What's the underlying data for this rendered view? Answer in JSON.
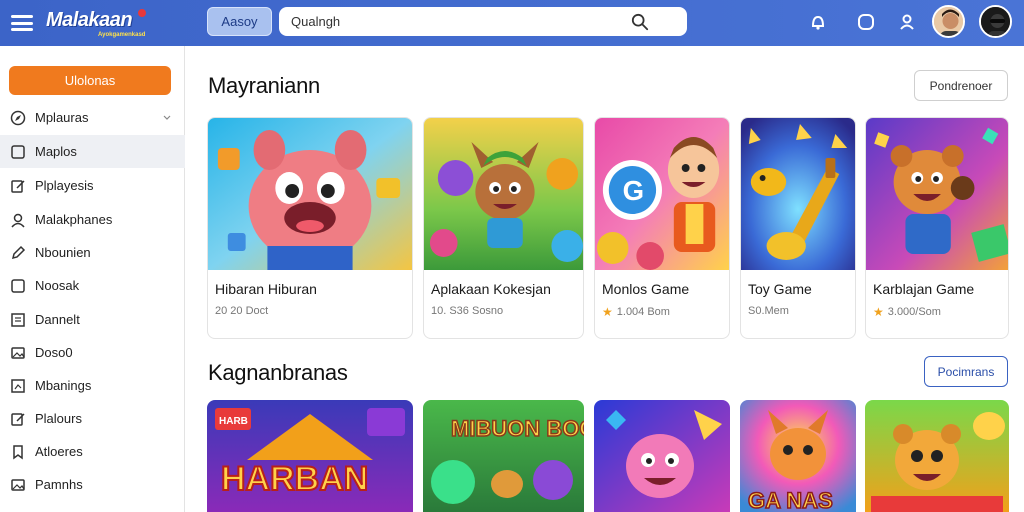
{
  "header": {
    "logo_text": "Malakaan",
    "logo_sub": "Ayokgamenkasd",
    "category_label": "Aasoy",
    "search_placeholder": "Qualngh"
  },
  "sidebar": {
    "primary_label": "Ulolonas",
    "items": [
      {
        "label": "Mplauras",
        "icon": "compass-icon",
        "has_chevron": true
      },
      {
        "label": "Maplos",
        "icon": "square-icon"
      },
      {
        "label": "Plplayesis",
        "icon": "edit-icon"
      },
      {
        "label": "Malakphanes",
        "icon": "user-icon"
      },
      {
        "label": "Nbounien",
        "icon": "pencil-icon"
      },
      {
        "label": "Noosak",
        "icon": "square-icon"
      },
      {
        "label": "Dannelt",
        "icon": "document-icon"
      },
      {
        "label": "Doso0",
        "icon": "image-icon"
      },
      {
        "label": "Mbanings",
        "icon": "chart-icon"
      },
      {
        "label": "Plalours",
        "icon": "edit-icon"
      },
      {
        "label": "Atloeres",
        "icon": "bookmark-icon"
      },
      {
        "label": "Pamnhs",
        "icon": "image-icon"
      }
    ]
  },
  "section1": {
    "title": "Mayraniann",
    "button_label": "Pondrenoer",
    "cards": [
      {
        "title": "Hibaran Hiburan",
        "meta": "20 20 Doct",
        "star": false
      },
      {
        "title": "Aplakaan Kokesjan",
        "meta": "10. S36 Sosno",
        "star": false
      },
      {
        "title": "Monlos Game",
        "meta": "1.004 Bom",
        "star": true
      },
      {
        "title": "Toy Game",
        "meta": "S0.Mem",
        "star": false
      },
      {
        "title": "Karblajan Game",
        "meta": "3.000/Som",
        "star": true
      }
    ]
  },
  "section2": {
    "title": "Kagnanbranas",
    "button_label": "Pocimrans",
    "cards": [
      {
        "thumb_text": "HARBAN",
        "badge": "HARB"
      },
      {
        "thumb_text": "MIBUON BOODIGNIS"
      },
      {
        "thumb_text": ""
      },
      {
        "thumb_text": "GA NAS"
      },
      {
        "thumb_text": ""
      }
    ]
  },
  "colors": {
    "header_blue": "#4068cc",
    "accent_orange": "#f07a1e",
    "button_blue": "#3a62c2"
  }
}
